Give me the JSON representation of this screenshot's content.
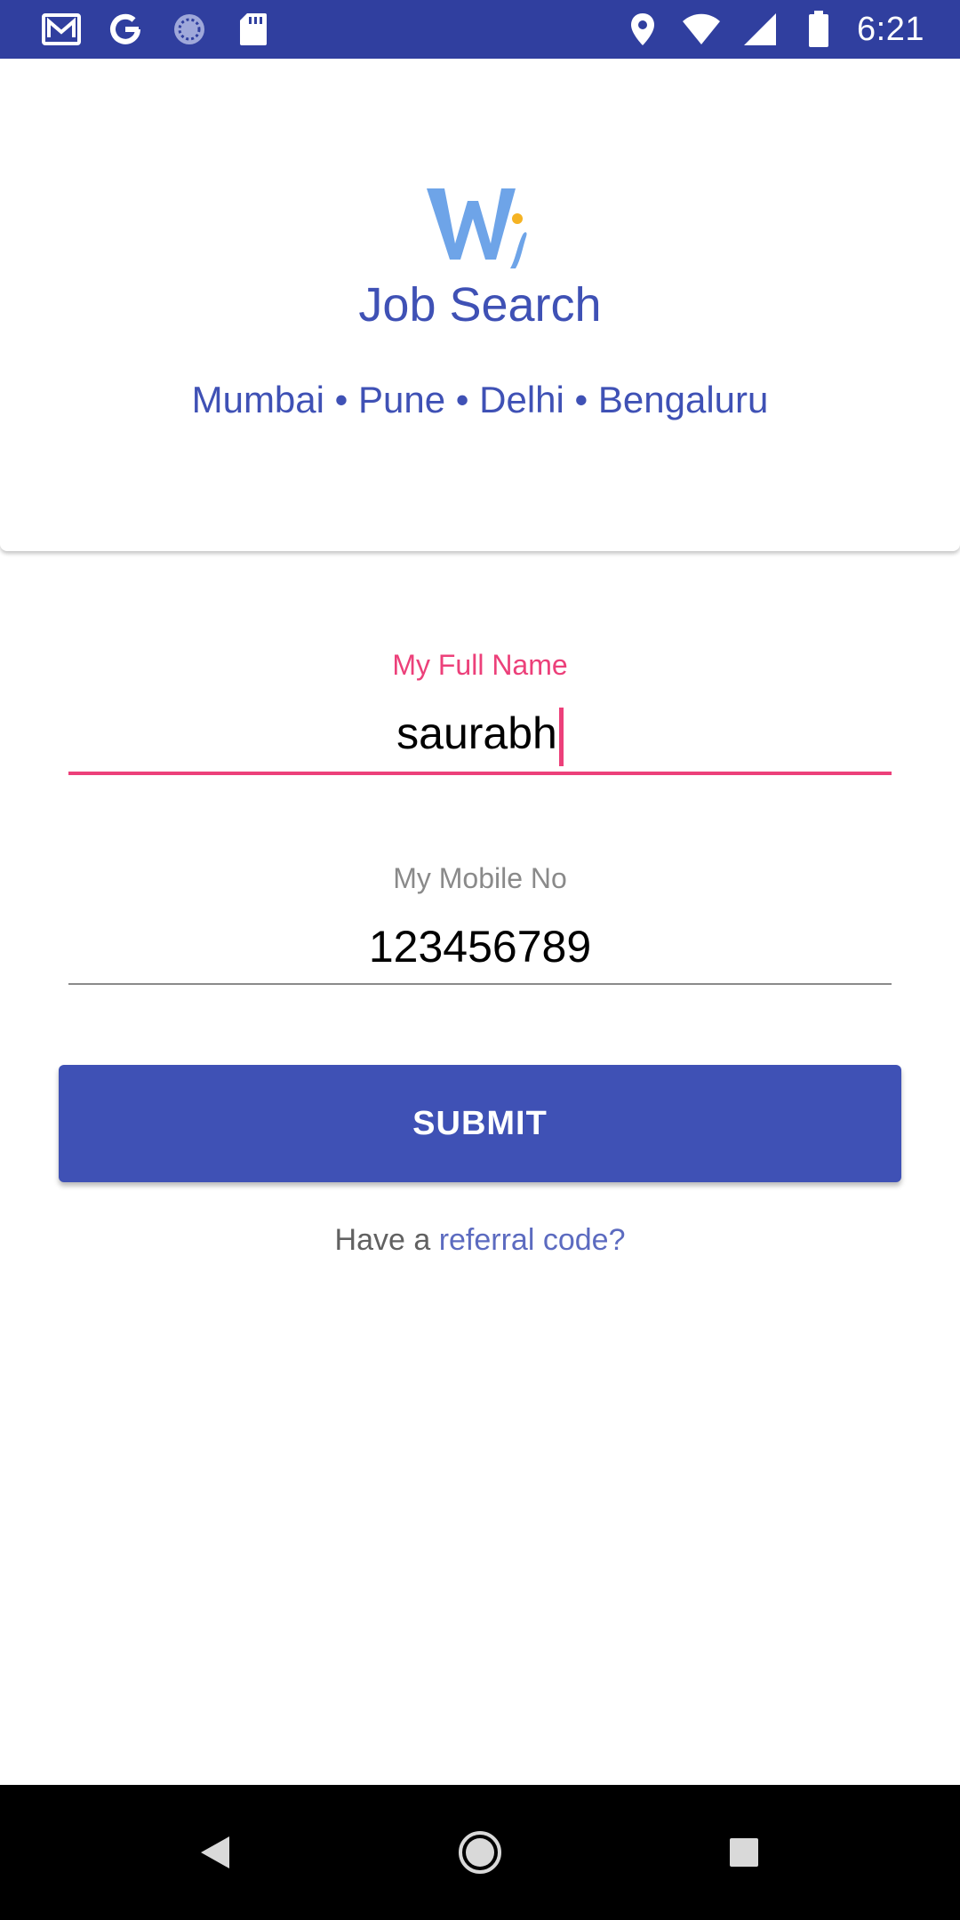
{
  "status_bar": {
    "time": "6:21",
    "left_icons": [
      "gmail-icon",
      "google-icon",
      "sync-icon",
      "sd-card-icon"
    ],
    "right_icons": [
      "location-icon",
      "wifi-icon",
      "signal-icon",
      "battery-icon"
    ]
  },
  "header": {
    "logo_name": "wi-logo",
    "title": "Job Search",
    "cities": "Mumbai • Pune • Delhi • Bengaluru"
  },
  "form": {
    "name_label": "My Full Name",
    "name_value": "saurabh",
    "mobile_label": "My Mobile No",
    "mobile_value": "123456789",
    "submit_label": "SUBMIT",
    "referral_prefix": "Have a ",
    "referral_link": "referral code?"
  },
  "colors": {
    "primary": "#3F51B5",
    "status_bar": "#303F9F",
    "accent": "#EC407A",
    "link": "#5C6BC0"
  },
  "nav_bar": {
    "buttons": [
      "back-icon",
      "home-icon",
      "recents-icon"
    ]
  }
}
